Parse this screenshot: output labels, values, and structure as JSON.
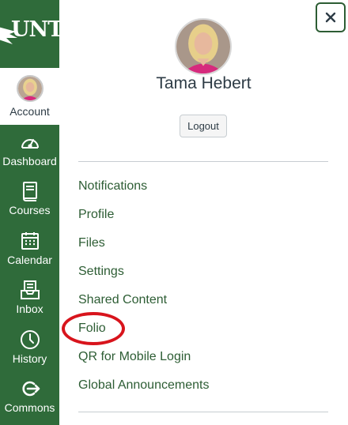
{
  "brand": {
    "logo_text": "UNT"
  },
  "global_nav": {
    "account_label": "Account",
    "items": [
      {
        "label": "Dashboard",
        "icon": "dashboard-icon"
      },
      {
        "label": "Courses",
        "icon": "courses-icon"
      },
      {
        "label": "Calendar",
        "icon": "calendar-icon"
      },
      {
        "label": "Inbox",
        "icon": "inbox-icon"
      },
      {
        "label": "History",
        "icon": "history-icon"
      },
      {
        "label": "Commons",
        "icon": "commons-icon"
      }
    ]
  },
  "tray": {
    "user_name": "Tama Hebert",
    "logout_label": "Logout",
    "menu": [
      "Notifications",
      "Profile",
      "Files",
      "Settings",
      "Shared Content",
      "Folio",
      "QR for Mobile Login",
      "Global Announcements"
    ],
    "highlighted_item": "Folio"
  },
  "colors": {
    "nav_background": "#2f6b3a",
    "link": "#2d5d34",
    "highlight": "#d8141c"
  }
}
